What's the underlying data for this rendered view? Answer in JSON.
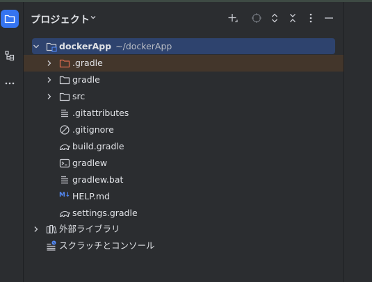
{
  "panel": {
    "title": "プロジェクト"
  },
  "tree": {
    "root": {
      "name": "dockerApp",
      "path": "~/dockerApp"
    },
    "items": [
      {
        "label": ".gradle"
      },
      {
        "label": "gradle"
      },
      {
        "label": "src"
      },
      {
        "label": ".gitattributes"
      },
      {
        "label": ".gitignore"
      },
      {
        "label": "build.gradle"
      },
      {
        "label": "gradlew"
      },
      {
        "label": "gradlew.bat"
      },
      {
        "label": "HELP.md",
        "badge": "M↓"
      },
      {
        "label": "settings.gradle"
      }
    ],
    "external_libraries": "外部ライブラリ",
    "scratches": "スクラッチとコンソール"
  },
  "colors": {
    "background": "#2b2d30",
    "accent": "#3574f0",
    "selection": "#2e436e",
    "excluded_folder": "#e06c4f"
  }
}
